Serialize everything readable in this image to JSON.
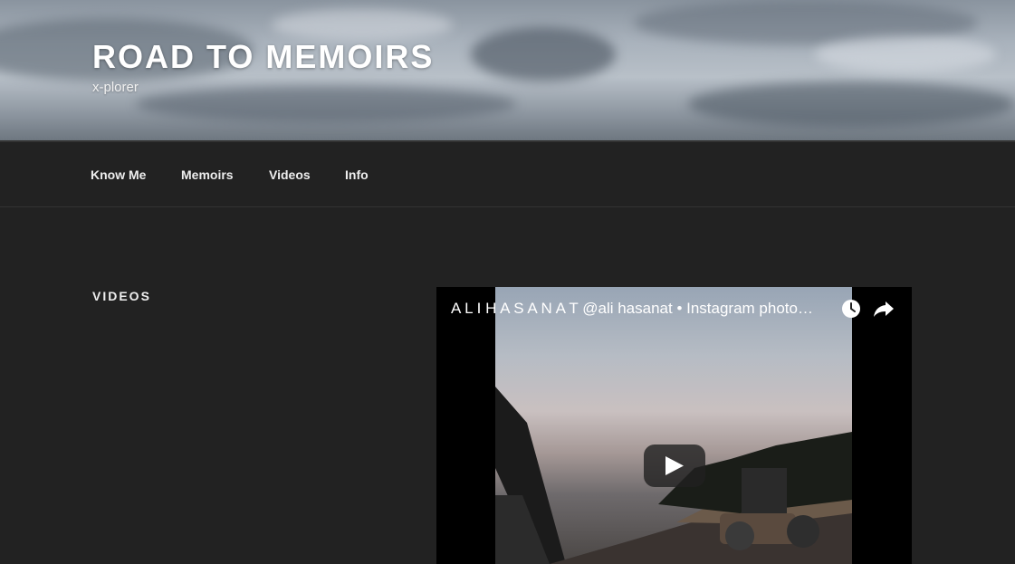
{
  "site": {
    "title": "ROAD TO MEMOIRS",
    "description": "x-plorer"
  },
  "nav": {
    "items": [
      {
        "label": "Know Me"
      },
      {
        "label": "Memoirs"
      },
      {
        "label": "Videos"
      },
      {
        "label": "Info"
      }
    ]
  },
  "widget": {
    "title": "VIDEOS"
  },
  "video": {
    "title": "A L I H A S A N A T @ali hasanat • Instagram photo…",
    "icons": [
      "clock-icon",
      "share-icon",
      "play-icon"
    ]
  },
  "colors": {
    "background": "#222222",
    "text": "#eeeeee",
    "header_text": "#ffffff"
  }
}
